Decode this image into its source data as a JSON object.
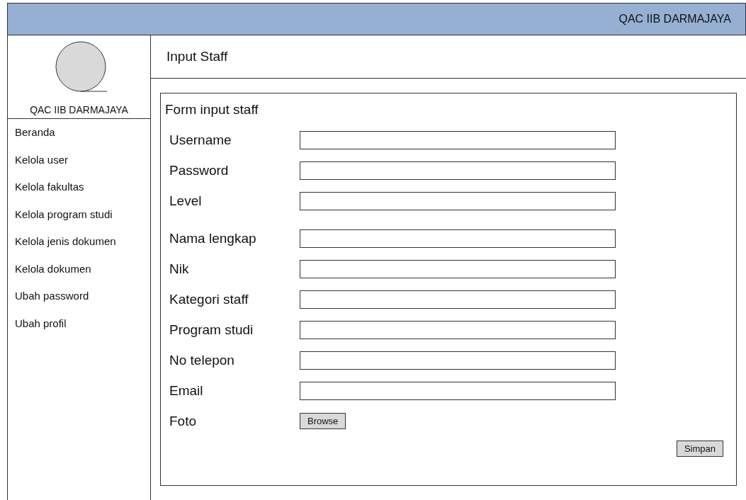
{
  "header": {
    "title": "QAC IIB DARMAJAYA"
  },
  "sidebar": {
    "brand": "QAC IIB DARMAJAYA",
    "items": [
      {
        "label": "Beranda"
      },
      {
        "label": "Kelola user"
      },
      {
        "label": "Kelola fakultas"
      },
      {
        "label": "Kelola program studi"
      },
      {
        "label": "Kelola jenis dokumen"
      },
      {
        "label": "Kelola dokumen"
      },
      {
        "label": "Ubah password"
      },
      {
        "label": "Ubah profil"
      }
    ]
  },
  "page": {
    "title": "Input Staff"
  },
  "form": {
    "title": "Form input staff",
    "fields": [
      {
        "label": "Username",
        "kind": "text"
      },
      {
        "label": "Password",
        "kind": "text"
      },
      {
        "label": "Level",
        "kind": "text"
      },
      {
        "label": "Nama lengkap",
        "kind": "text"
      },
      {
        "label": "Nik",
        "kind": "text"
      },
      {
        "label": "Kategori staff",
        "kind": "text"
      },
      {
        "label": "Program studi",
        "kind": "text"
      },
      {
        "label": "No telepon",
        "kind": "text"
      },
      {
        "label": "Email",
        "kind": "text"
      },
      {
        "label": "Foto",
        "kind": "file",
        "button": "Browse"
      }
    ],
    "submit": "Simpan"
  }
}
